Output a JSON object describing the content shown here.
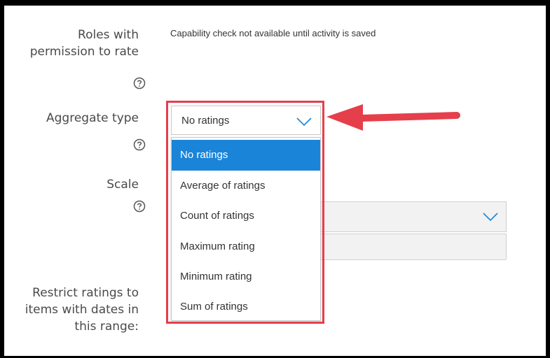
{
  "labels": {
    "roles": [
      "Roles with",
      "permission to rate"
    ],
    "aggregate": "Aggregate type",
    "scale": "Scale",
    "restrict": [
      "Restrict ratings to",
      "items with dates in",
      "this range:"
    ]
  },
  "capability_note": "Capability check not available until activity is saved",
  "aggregate_select": {
    "value": "No ratings",
    "options": [
      "No ratings",
      "Average of ratings",
      "Count of ratings",
      "Maximum rating",
      "Minimum rating",
      "Sum of ratings"
    ],
    "selected_index": 0
  },
  "icons": {
    "help": "question-circle-icon",
    "dropdown": "chevron-down-icon",
    "annotation": "red-arrow-icon"
  },
  "colors": {
    "highlight": "#e53f4b",
    "selected_option": "#1a85d8",
    "chevron": "#1a85d8"
  }
}
